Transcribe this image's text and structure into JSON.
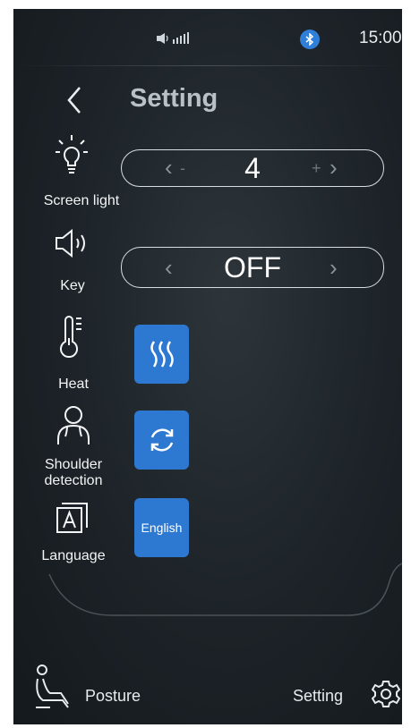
{
  "status": {
    "time": "15:00"
  },
  "header": {
    "title": "Setting"
  },
  "screen_light": {
    "label": "Screen light",
    "value": "4",
    "minus": "-",
    "plus": "+"
  },
  "key": {
    "label": "Key",
    "value": "OFF"
  },
  "heat": {
    "label": "Heat"
  },
  "shoulder": {
    "label": "Shoulder detection"
  },
  "language": {
    "label": "Language",
    "button": "English"
  },
  "bottom": {
    "posture": "Posture",
    "setting": "Setting"
  },
  "colors": {
    "accent": "#2d78d0",
    "bluetooth": "#2f7fd8"
  }
}
